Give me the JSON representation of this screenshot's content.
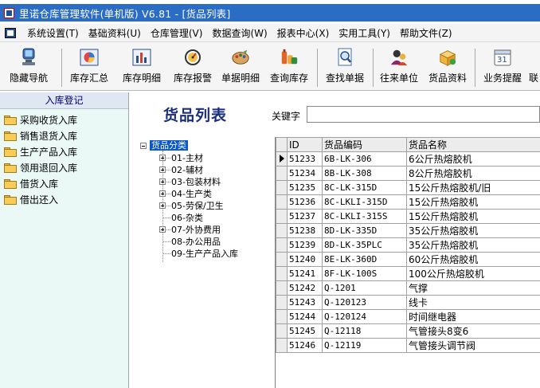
{
  "window": {
    "title": "里诺仓库管理软件(单机版) V6.81 - [货品列表]"
  },
  "menu": {
    "items": [
      "系统设置(T)",
      "基础资料(U)",
      "仓库管理(V)",
      "数据查询(W)",
      "报表中心(X)",
      "实用工具(Y)",
      "帮助文件(Z)"
    ]
  },
  "toolbar": {
    "buttons": [
      {
        "label": "隐藏导航",
        "icon": "monitor-icon"
      },
      {
        "label": "库存汇总",
        "icon": "pie-chart-icon"
      },
      {
        "label": "库存明细",
        "icon": "bar-chart-icon"
      },
      {
        "label": "库存报警",
        "icon": "alarm-gauge-icon"
      },
      {
        "label": "单据明细",
        "icon": "paint-palette-icon"
      },
      {
        "label": "查询库存",
        "icon": "bottles-icon"
      },
      {
        "label": "查找单据",
        "icon": "magnifier-document-icon"
      },
      {
        "label": "往来单位",
        "icon": "people-icon"
      },
      {
        "label": "货品资料",
        "icon": "package-icon"
      },
      {
        "label": "业务提醒",
        "icon": "calendar-icon"
      },
      {
        "label": "联",
        "icon": ""
      }
    ],
    "calendar_day": "31"
  },
  "sidebar": {
    "header": "入库登记",
    "items": [
      "采购收货入库",
      "销售退货入库",
      "生产产品入库",
      "领用退回入库",
      "借货入库",
      "借出还入"
    ]
  },
  "main": {
    "title": "货品列表",
    "keyword_label": "关键字",
    "keyword_value": ""
  },
  "tree": {
    "root": "货品分类",
    "nodes": [
      "01-主材",
      "02-辅材",
      "03-包装材料",
      "04-生产类",
      "05-劳保/卫生",
      "06-杂类",
      "07-外协费用",
      "08-办公用品",
      "09-生产产品入库"
    ]
  },
  "grid": {
    "headers": [
      "ID",
      "货品编码",
      "货品名称"
    ],
    "rows": [
      [
        "51233",
        "6B-LK-306",
        "6公斤热熔胶机"
      ],
      [
        "51234",
        "8B-LK-308",
        "8公斤热熔胶机"
      ],
      [
        "51235",
        "8C-LK-315D",
        "15公斤热熔胶机/旧"
      ],
      [
        "51236",
        "8C-LKLI-315D",
        "15公斤热熔胶机"
      ],
      [
        "51237",
        "8C-LKLI-315S",
        "15公斤热熔胶机"
      ],
      [
        "51238",
        "8D-LK-335D",
        "35公斤热熔胶机"
      ],
      [
        "51239",
        "8D-LK-35PLC",
        "35公斤热熔胶机"
      ],
      [
        "51240",
        "8E-LK-360D",
        "60公斤热熔胶机"
      ],
      [
        "51241",
        "8F-LK-100S",
        "100公斤热熔胶机"
      ],
      [
        "51242",
        "Q-1201",
        "气撑"
      ],
      [
        "51243",
        "Q-120123",
        "线卡"
      ],
      [
        "51244",
        "Q-120124",
        "时间继电器"
      ],
      [
        "51245",
        "Q-12118",
        "气管接头8变6"
      ],
      [
        "51246",
        "Q-12119",
        "气管接头调节阀"
      ]
    ]
  }
}
